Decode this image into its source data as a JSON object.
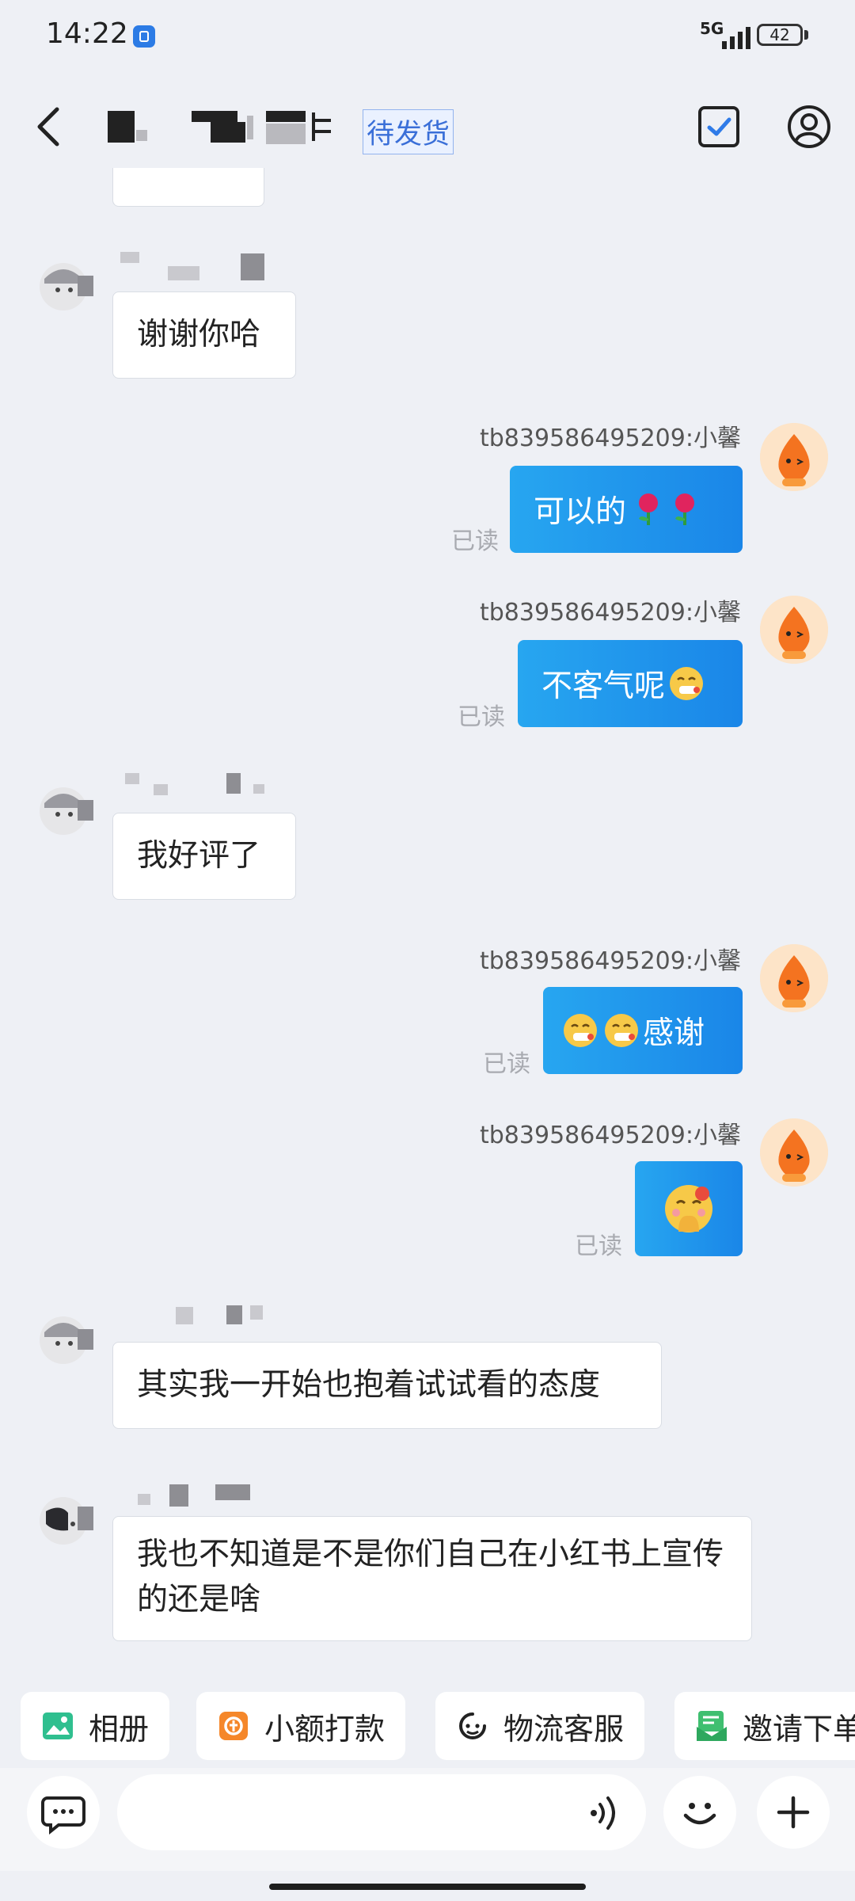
{
  "status_bar": {
    "time": "14:22",
    "network": "5G",
    "battery": "42"
  },
  "header": {
    "order_status": "待发货"
  },
  "messages": [
    {
      "text": "谢谢你哈"
    },
    {
      "sender": "tb839586495209:小馨",
      "text": "可以的",
      "emoji": [
        "rose",
        "rose"
      ],
      "read": "已读"
    },
    {
      "sender": "tb839586495209:小馨",
      "text": "不客气呢",
      "emoji": [
        "sneezing-face"
      ],
      "read": "已读"
    },
    {
      "text": "我好评了"
    },
    {
      "sender": "tb839586495209:小馨",
      "text": "感谢",
      "emoji": [
        "sneezing-face",
        "sneezing-face"
      ],
      "read": "已读"
    },
    {
      "sender": "tb839586495209:小馨",
      "emoji": [
        "blushing-hands-face"
      ],
      "read": "已读"
    },
    {
      "text": "其实我一开始也抱着试试看的态度"
    },
    {
      "text": "我也不知道是不是你们自己在小红书上宣传的还是啥"
    }
  ],
  "shortcuts": [
    {
      "label": "相册",
      "icon": "photo-album-icon",
      "color": "#2fbf8f"
    },
    {
      "label": "小额打款",
      "icon": "payment-icon",
      "color": "#f5872a"
    },
    {
      "label": "物流客服",
      "icon": "logistics-service-icon",
      "color": "#222222"
    },
    {
      "label": "邀请下单",
      "icon": "invite-order-icon",
      "color": "#3fbf70"
    }
  ],
  "input_bar": {
    "placeholder": ""
  },
  "colors": {
    "accent": "#1a86e8",
    "bubble_out": "#27a6f0",
    "order_status": "#3a6fd8"
  }
}
